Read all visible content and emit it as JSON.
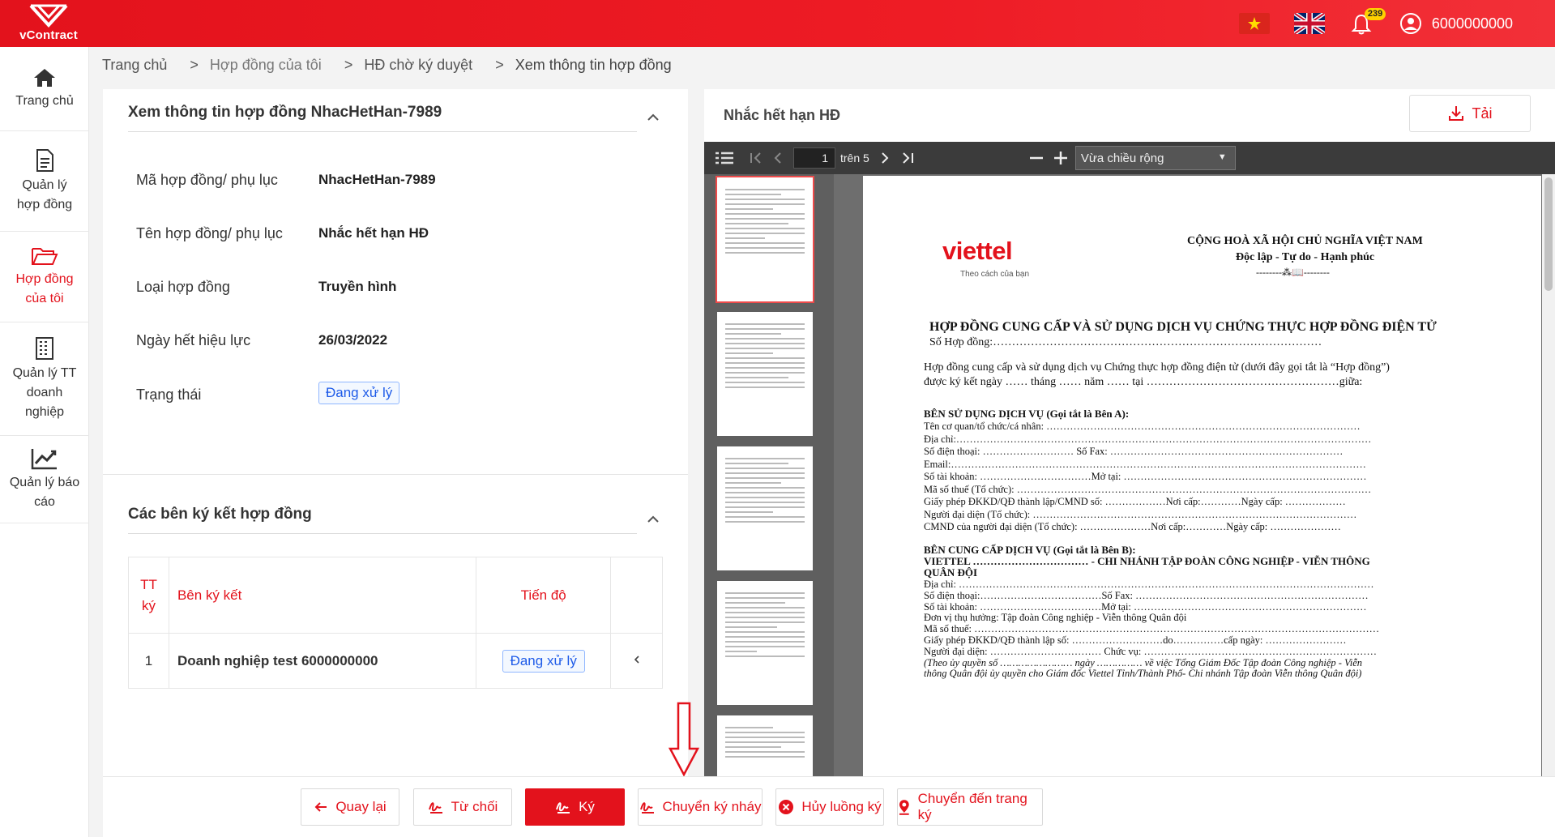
{
  "header": {
    "logo_text": "vContract",
    "notification_count": "239",
    "user_name": "6000000000"
  },
  "sidebar": {
    "items": [
      {
        "label": "Trang chủ",
        "icon": "home-icon"
      },
      {
        "label": "Quản lý hợp đồng",
        "icon": "document-icon"
      },
      {
        "label": "Hợp đồng của tôi",
        "icon": "folder-open-icon",
        "active": true
      },
      {
        "label": "Quản lý TT doanh nghiệp",
        "icon": "building-icon"
      },
      {
        "label": "Quản lý báo cáo",
        "icon": "chart-icon"
      }
    ]
  },
  "breadcrumb": [
    "Trang chủ",
    "Hợp đồng của tôi",
    "HĐ chờ ký duyệt",
    "Xem thông tin hợp đồng"
  ],
  "contract_info": {
    "title": "Xem thông tin hợp đồng NhacHetHan-7989",
    "rows": [
      {
        "label": "Mã hợp đồng/ phụ lục",
        "value": "NhacHetHan-7989"
      },
      {
        "label": "Tên hợp đồng/ phụ lục",
        "value": "Nhắc hết hạn HĐ"
      },
      {
        "label": "Loại hợp đồng",
        "value": "Truyền hình"
      },
      {
        "label": "Ngày hết hiệu lực",
        "value": "26/03/2022"
      },
      {
        "label": "Trạng thái",
        "value": "Đang xử lý"
      }
    ]
  },
  "signers": {
    "title": "Các bên ký kết hợp đồng",
    "columns": [
      "TT ký",
      "Bên ký kết",
      "Tiến độ"
    ],
    "rows": [
      {
        "order": "1",
        "party": "Doanh nghiệp test 6000000000",
        "progress": "Đang xử lý"
      }
    ]
  },
  "document": {
    "title": "Nhắc hết hạn HĐ",
    "download_label": "Tải",
    "current_page": "1",
    "page_total": "trên 5",
    "zoom": "Vừa chiều rộng",
    "content": {
      "logo": "viettel",
      "logo_tagline": "Theo cách của bạn",
      "header1": "CỘNG HOÀ XÃ HỘI CHỦ NGHĨA VIỆT NAM",
      "header2": "Độc lập - Tự do - Hạnh phúc",
      "header3": "--------⁂📖--------",
      "title": "HỢP ĐỒNG CUNG CẤP VÀ SỬ DỤNG DỊCH VỤ CHỨNG THỰC HỢP ĐỒNG ĐIỆN TỬ",
      "number": "Số Hợp đồng:……………………………………………………………………………",
      "intro1": "Hợp đồng cung cấp và sử dụng dịch vụ Chứng thực hợp đồng điện tử (dưới đây gọi tắt là “Hợp đồng”)",
      "intro2": "được ký kết ngày …… tháng …… năm …… tại ……………………………………………giữa:",
      "partyA_title": "BÊN SỬ DỤNG DỊCH VỤ (Gọi tắt là Bên A):",
      "partyA_lines": [
        "Tên cơ quan/tổ chức/cá nhân: …………………………………………………………………………………",
        "Địa chỉ:……………………………………………………………………………………………………………",
        "Số điện thoại: ……………………… Số Fax: ……………………………………………………………",
        "Email:……………………………………………………………………………………………………………",
        "Số tài khoản: ……………………………Mở tại: ………………………………………………………………",
        "Mã số thuế (Tổ chức): ……………………………………………………………………………………………",
        "Giấy phép ĐKKD/QĐ thành lập/CMND số: ………………Nơi cấp:…………Ngày cấp: ………………",
        "Người đại diện (Tổ chức): ……………………………………………………………………………………",
        "CMND của người đại diện (Tổ chức): …………………Nơi cấp:…………Ngày cấp: …………………"
      ],
      "partyB_title": "BÊN CUNG CẤP DỊCH VỤ (Gọi tắt là Bên B):",
      "partyB_name": "VIETTEL …………………………… - CHI NHÁNH TẬP ĐOÀN CÔNG NGHIỆP - VIỄN THÔNG",
      "partyB_name2": "QUÂN ĐỘI",
      "partyB_lines": [
        "Địa chỉ: ……………………………………………………………………………………………………………",
        "Số điện thoại:………………………………Số Fax: ……………………………………………………………",
        "Số tài khoản: ………………………………Mở tại: ……………………………………………………………",
        "Đơn vị thụ hưởng: Tập đoàn Công nghiệp - Viễn thông Quân đội",
        "Mã số thuế: …………………………………………………………………………………………………………",
        "Giấy phép ĐKKD/QĐ thành lập số: ………………………do……………cấp ngày: ……………………",
        "Người đại diện: …………………………… Chức vụ: ……………………………………………………………",
        "(Theo ủy quyền số …………………… ngày …………… về việc Tổng Giám Đốc Tập đoàn Công nghiệp - Viễn",
        "thông Quân đội ủy quyền cho Giám đốc Viettel Tỉnh/Thành Phố- Chi nhánh Tập đoàn Viễn thông Quân đội)"
      ]
    }
  },
  "actions": {
    "back": "Quay lại",
    "reject": "Từ chối",
    "sign": "Ký",
    "forward_initial": "Chuyển ký nháy",
    "cancel_flow": "Hủy luồng ký",
    "goto_sign_page": "Chuyển đến trang ký"
  },
  "colors": {
    "brand": "#e3121c",
    "status_blue": "#1e5be8"
  }
}
